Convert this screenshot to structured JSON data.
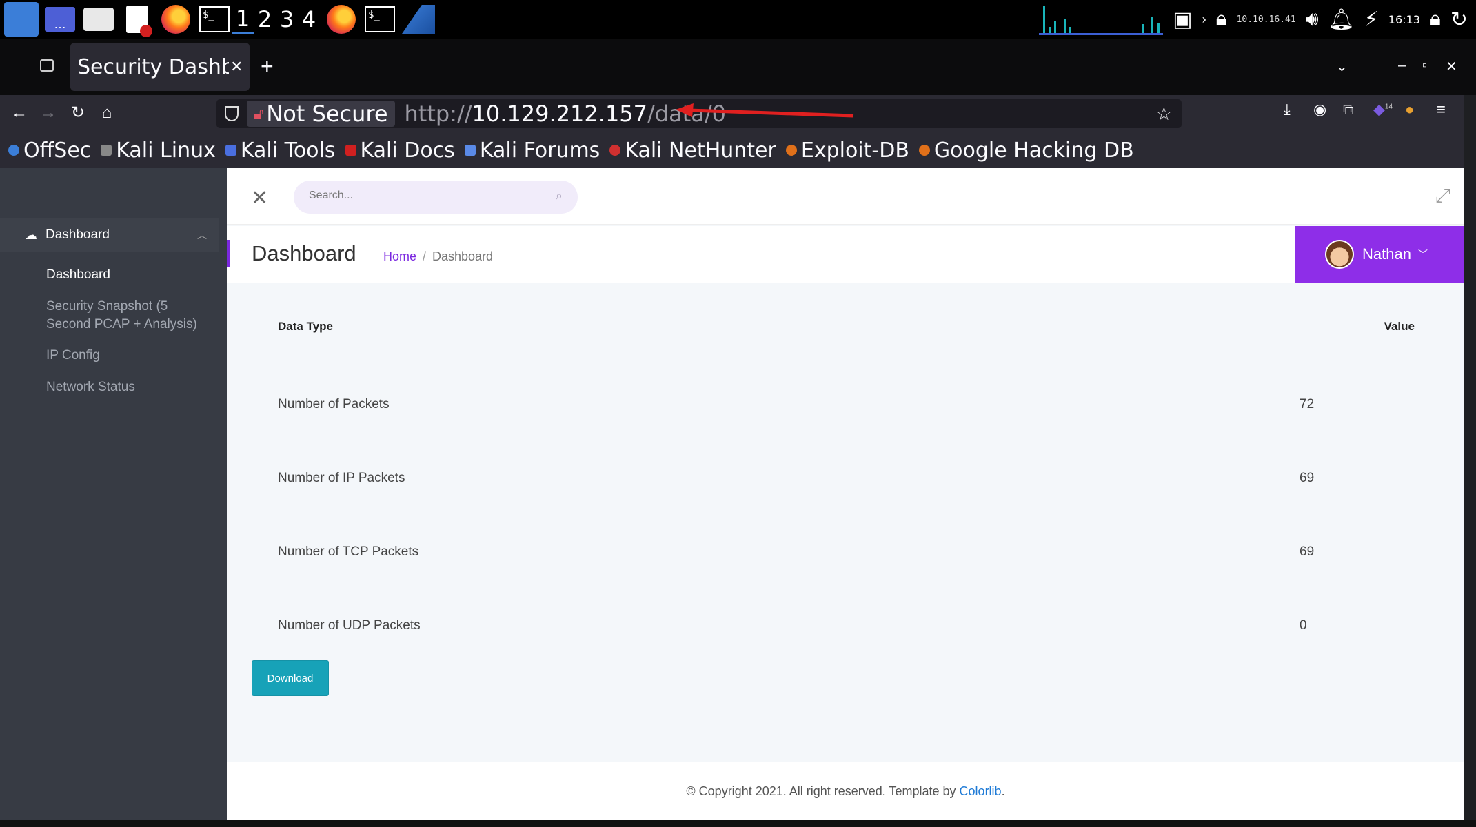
{
  "taskbar": {
    "workspaces": [
      "1",
      "2",
      "3",
      "4"
    ],
    "ip": "10.10.16.41",
    "time": "16:13"
  },
  "browser": {
    "tab_title": "Security Dashboard",
    "not_secure_label": "Not Secure",
    "url_scheme": "http://",
    "url_host": "10.129.212.157",
    "url_path": "/data/0",
    "extension_badge": "14",
    "bookmarks": [
      "OffSec",
      "Kali Linux",
      "Kali Tools",
      "Kali Docs",
      "Kali Forums",
      "Kali NetHunter",
      "Exploit-DB",
      "Google Hacking DB"
    ]
  },
  "sidebar": {
    "section_label": "Dashboard",
    "items": [
      {
        "label": "Dashboard"
      },
      {
        "label": "Security Snapshot (5"
      },
      {
        "label": "Second PCAP + Analysis)"
      },
      {
        "label": "IP Config"
      },
      {
        "label": "Network Status"
      }
    ]
  },
  "topbar": {
    "search_placeholder": "Search..."
  },
  "header": {
    "title": "Dashboard",
    "breadcrumb_home": "Home",
    "breadcrumb_sep": "/",
    "breadcrumb_current": "Dashboard",
    "user_name": "Nathan"
  },
  "table": {
    "col_type": "Data Type",
    "col_value": "Value",
    "rows": [
      {
        "label": "Number of Packets",
        "value": "72"
      },
      {
        "label": "Number of IP Packets",
        "value": "69"
      },
      {
        "label": "Number of TCP Packets",
        "value": "69"
      },
      {
        "label": "Number of UDP Packets",
        "value": "0"
      }
    ]
  },
  "download_label": "Download",
  "footer": {
    "text": "© Copyright 2021. All right reserved. Template by ",
    "link": "Colorlib",
    "end": "."
  }
}
